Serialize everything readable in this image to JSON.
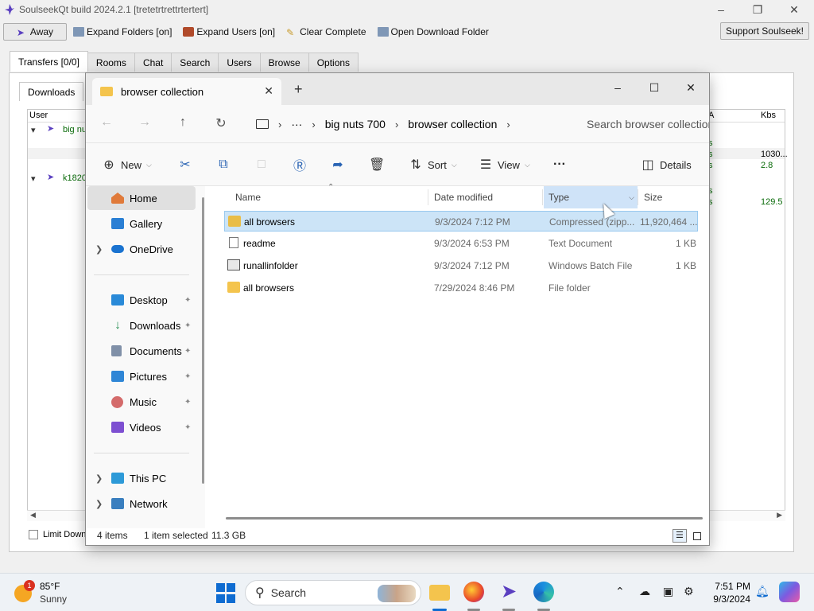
{
  "soulseek": {
    "title": "SoulseekQt build 2024.2.1 [tretetrtrettrtertert]",
    "toolbar": {
      "away": "Away",
      "expand_folders": "Expand Folders [on]",
      "expand_users": "Expand Users [on]",
      "clear_complete": "Clear Complete",
      "open_download_folder": "Open Download Folder",
      "support": "Support Soulseek!"
    },
    "tabs": [
      "Transfers [0/0]",
      "Rooms",
      "Chat",
      "Search",
      "Users",
      "Browse",
      "Options"
    ],
    "subtab": "Downloads",
    "columns": {
      "user": "User",
      "a": "A",
      "kbs": "Kbs"
    },
    "users": [
      "big nu",
      "k1820"
    ],
    "status_fragments": [
      "s",
      "s",
      "s",
      "s",
      "s"
    ],
    "kbs_values": [
      "1030...",
      "2.8",
      "129.5"
    ],
    "limit_label": "Limit Downl"
  },
  "explorer": {
    "tab_label": "browser collection",
    "breadcrumb": [
      "big nuts 700",
      "browser collection"
    ],
    "more_crumbs": "···",
    "search_placeholder": "Search browser collection",
    "commands": {
      "new": "New",
      "sort": "Sort",
      "view": "View",
      "more": "···",
      "details": "Details"
    },
    "sidebar": {
      "top": [
        {
          "label": "Home",
          "selected": true
        },
        {
          "label": "Gallery"
        },
        {
          "label": "OneDrive",
          "expandable": true
        }
      ],
      "pinned": [
        "Desktop",
        "Downloads",
        "Documents",
        "Pictures",
        "Music",
        "Videos"
      ],
      "bottom": [
        {
          "label": "This PC",
          "expandable": true
        },
        {
          "label": "Network",
          "expandable": true
        }
      ]
    },
    "columns": {
      "name": "Name",
      "date": "Date modified",
      "type": "Type",
      "size": "Size"
    },
    "files": [
      {
        "name": "all browsers",
        "date": "9/3/2024 7:12 PM",
        "type": "Compressed (zipp...",
        "size": "11,920,464 ...",
        "selected": true,
        "icon": "zip-folder-icon"
      },
      {
        "name": "readme",
        "date": "9/3/2024 6:53 PM",
        "type": "Text Document",
        "size": "1 KB",
        "icon": "text-file-icon"
      },
      {
        "name": "runallinfolder",
        "date": "9/3/2024 7:12 PM",
        "type": "Windows Batch File",
        "size": "1 KB",
        "icon": "batch-file-icon"
      },
      {
        "name": "all browsers",
        "date": "7/29/2024 8:46 PM",
        "type": "File folder",
        "size": "",
        "icon": "folder-icon"
      }
    ],
    "status": {
      "item_count": "4 items",
      "selection": "1 item selected",
      "selection_size": "11.3 GB"
    }
  },
  "taskbar": {
    "weather_temp": "85°F",
    "weather_cond": "Sunny",
    "weather_badge": "1",
    "search_label": "Search",
    "time": "7:51 PM",
    "date": "9/3/2024"
  },
  "colors": {
    "accent": "#0f6cd1",
    "selection": "#cce4f7",
    "folder": "#f4c44d",
    "transfer_green": "#0a6b0a"
  }
}
